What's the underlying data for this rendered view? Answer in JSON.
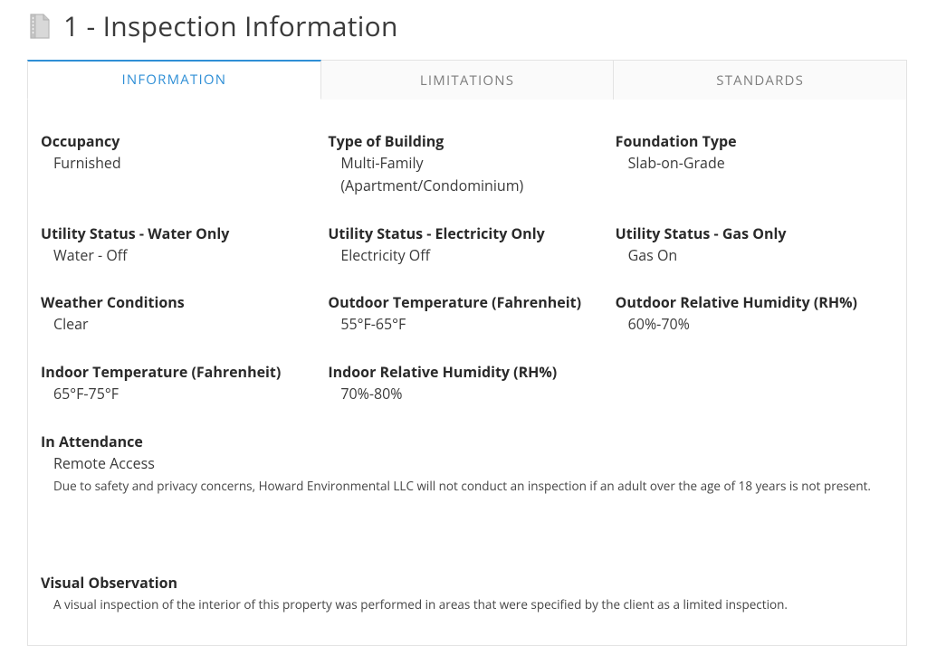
{
  "header": {
    "title": "1 - Inspection Information"
  },
  "tabs": {
    "information": "INFORMATION",
    "limitations": "LIMITATIONS",
    "standards": "STANDARDS"
  },
  "fields": {
    "occupancy": {
      "label": "Occupancy",
      "value": "Furnished"
    },
    "type_of_building": {
      "label": "Type of Building",
      "value": "Multi-Family (Apartment/Condominium)"
    },
    "foundation_type": {
      "label": "Foundation Type",
      "value": "Slab-on-Grade"
    },
    "utility_water": {
      "label": "Utility Status - Water Only",
      "value": "Water - Off"
    },
    "utility_electricity": {
      "label": "Utility Status - Electricity Only",
      "value": "Electricity Off"
    },
    "utility_gas": {
      "label": "Utility Status - Gas Only",
      "value": "Gas On"
    },
    "weather": {
      "label": "Weather Conditions",
      "value": "Clear"
    },
    "outdoor_temp": {
      "label": "Outdoor Temperature (Fahrenheit)",
      "value": "55°F-65°F"
    },
    "outdoor_rh": {
      "label": "Outdoor Relative Humidity (RH%)",
      "value": "60%-70%"
    },
    "indoor_temp": {
      "label": "Indoor Temperature (Fahrenheit)",
      "value": "65°F-75°F"
    },
    "indoor_rh": {
      "label": "Indoor Relative Humidity (RH%)",
      "value": "70%-80%"
    },
    "in_attendance": {
      "label": "In Attendance",
      "value": "Remote Access",
      "note": "Due to safety and privacy concerns, Howard Environmental LLC will not conduct an inspection if an adult over the age of 18 years is not present."
    },
    "visual_observation": {
      "label": "Visual Observation",
      "note": "A visual inspection of the interior of this property was performed in areas that were specified by the client as a limited inspection."
    }
  }
}
